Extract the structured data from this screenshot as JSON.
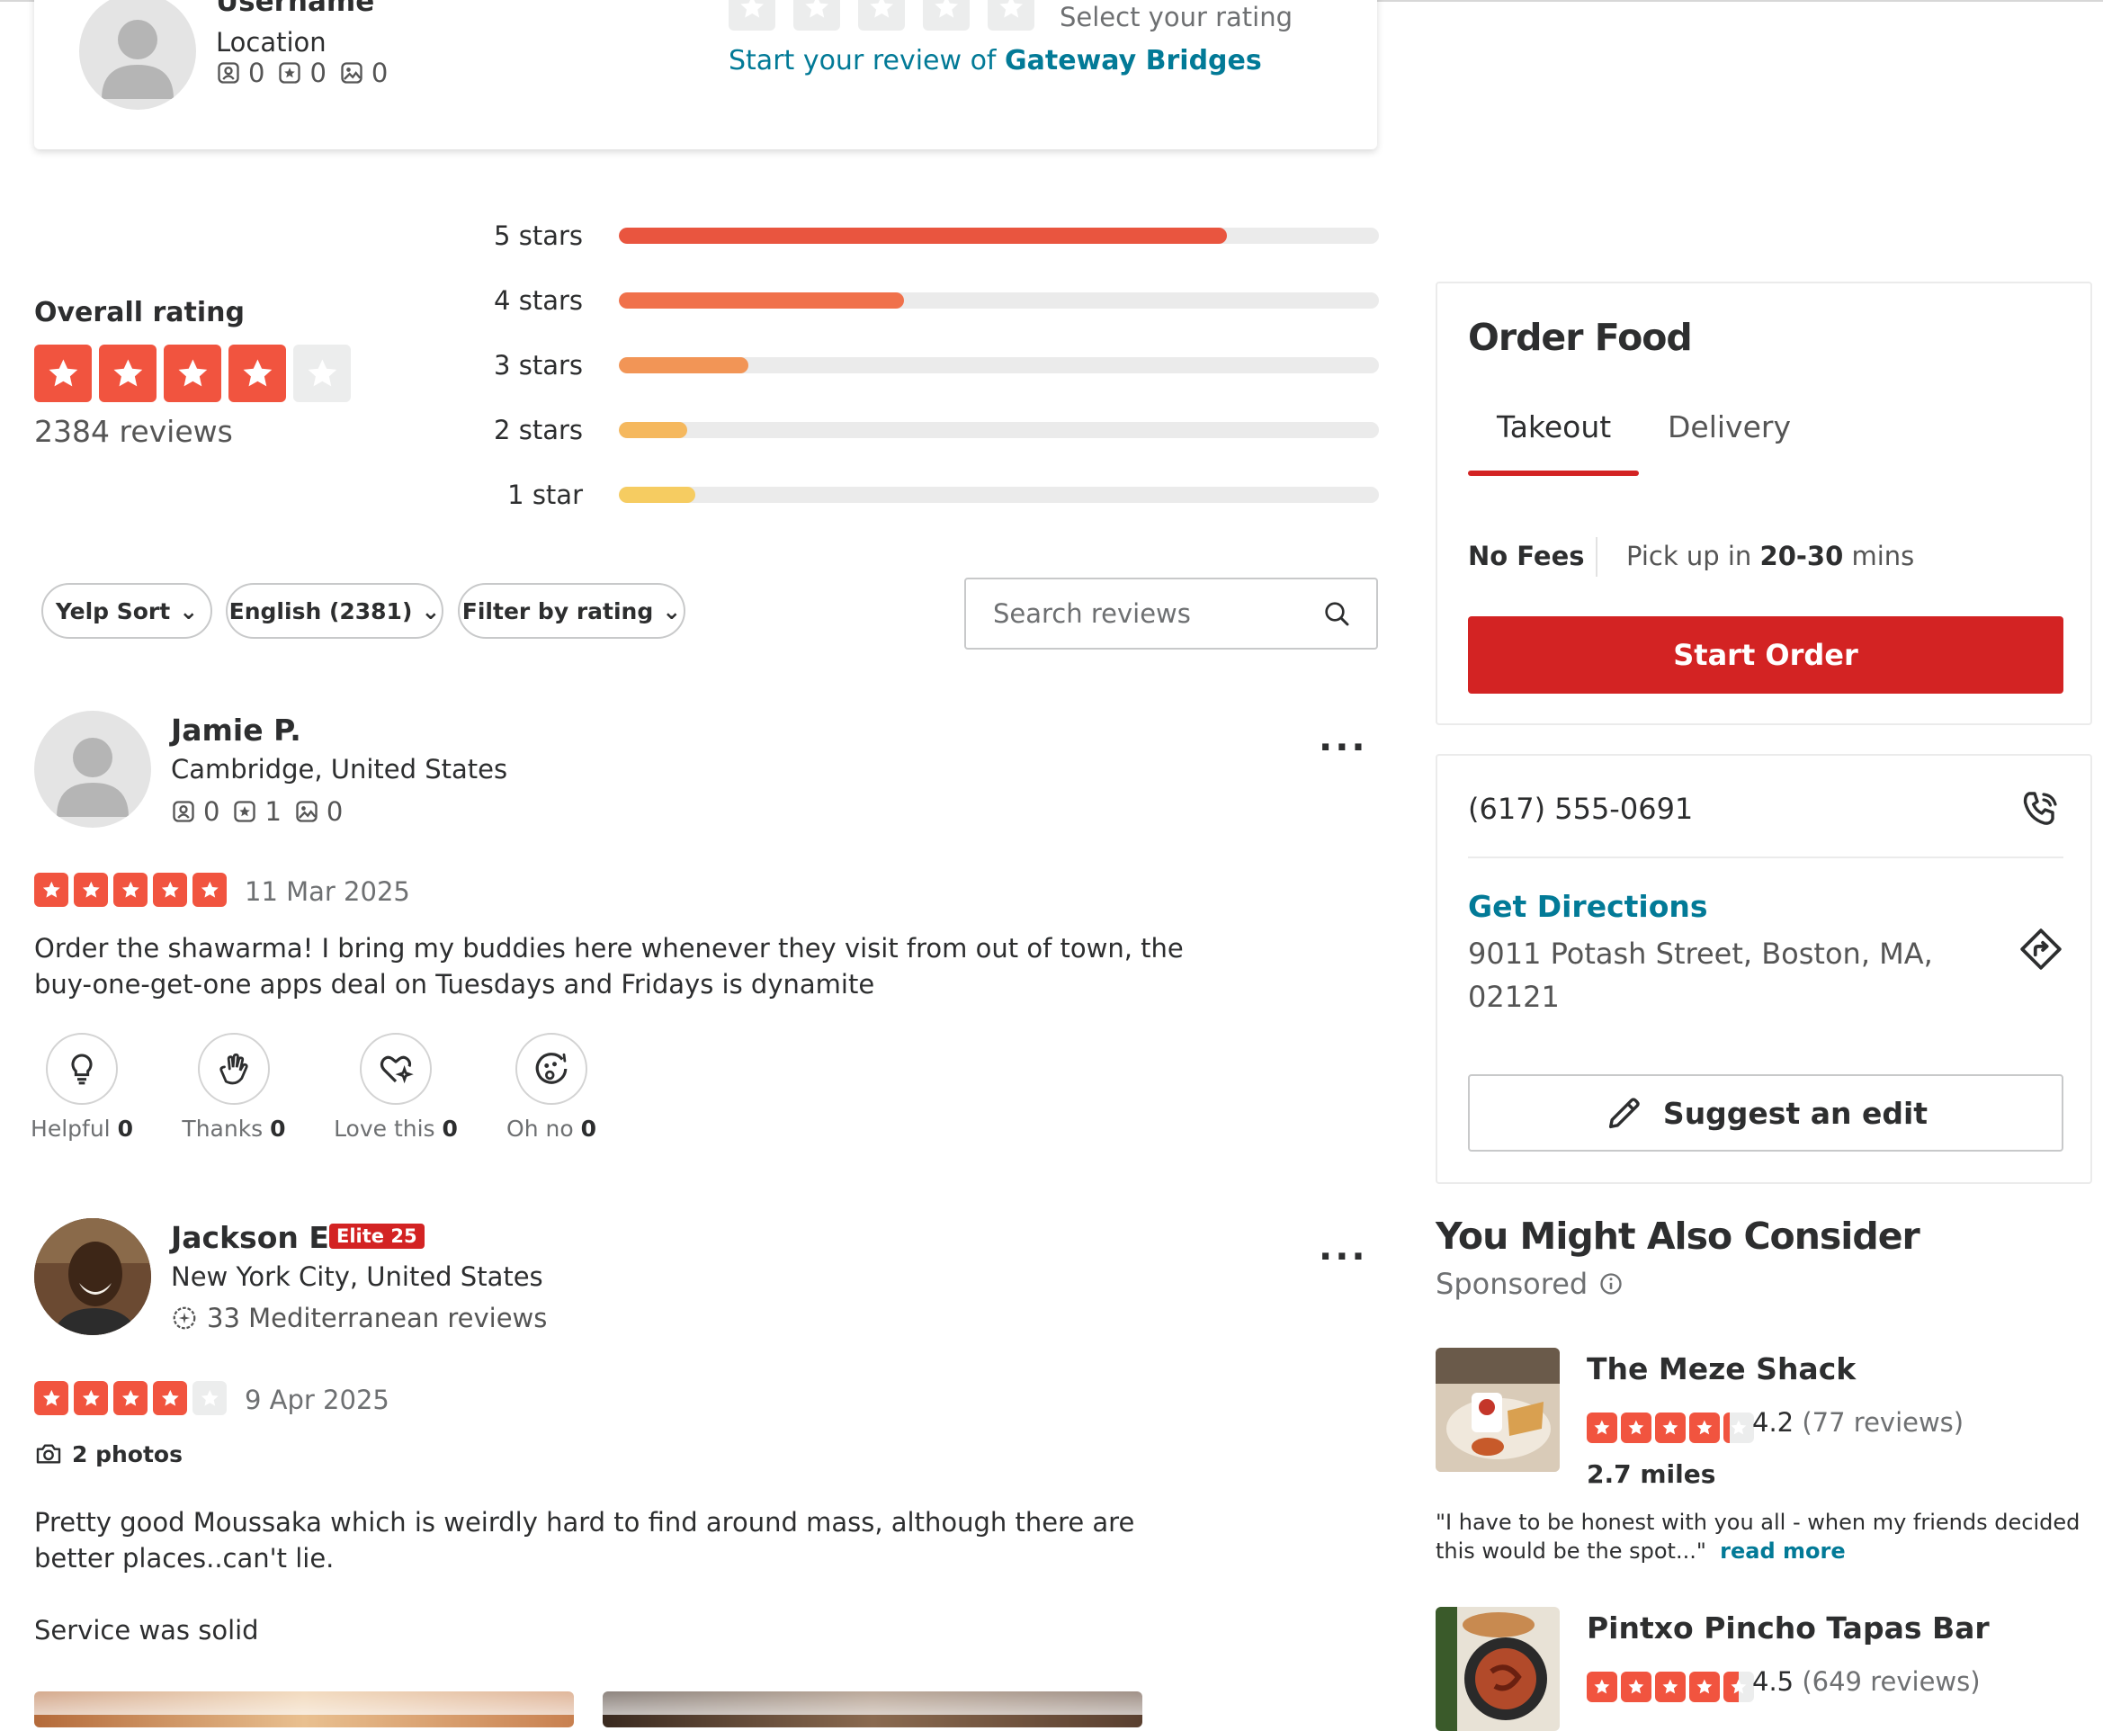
{
  "write_review": {
    "username": "Username",
    "location": "Location",
    "stats": [
      "0",
      "0",
      "0"
    ],
    "select_rating": "Select your rating",
    "start_prefix": "Start your review of ",
    "business": "Gateway Bridges"
  },
  "overall": {
    "heading": "Overall rating",
    "rating": 4,
    "reviews": "2384 reviews",
    "histogram": [
      {
        "label": "5 stars",
        "fraction": 0.8,
        "color": "#e9553f"
      },
      {
        "label": "4 stars",
        "fraction": 0.375,
        "color": "#f0714b"
      },
      {
        "label": "3 stars",
        "fraction": 0.17,
        "color": "#f29556"
      },
      {
        "label": "2 stars",
        "fraction": 0.09,
        "color": "#f5b85e"
      },
      {
        "label": "1 star",
        "fraction": 0.1,
        "color": "#f6cc61"
      }
    ]
  },
  "filters": {
    "sort": "Yelp Sort",
    "language": "English (2381)",
    "rating": "Filter by rating",
    "search_placeholder": "Search reviews"
  },
  "reviews": [
    {
      "name": "Jamie P.",
      "location": "Cambridge, United States",
      "stats": [
        "0",
        "1",
        "0"
      ],
      "rating": 5,
      "date": "11 Mar 2025",
      "text": "Order the shawarma! I bring my buddies here whenever they visit from out of town, the buy-one-get-one apps deal on Tuesdays and Fridays is dynamite",
      "reactions": [
        {
          "label": "Helpful",
          "count": "0"
        },
        {
          "label": "Thanks",
          "count": "0"
        },
        {
          "label": "Love this",
          "count": "0"
        },
        {
          "label": "Oh no",
          "count": "0"
        }
      ]
    },
    {
      "name": "Jackson E.",
      "badge": "Elite 25",
      "location": "New York City, United States",
      "cuisine_reviews": "33 Mediterranean reviews",
      "rating": 4,
      "date": "9 Apr 2025",
      "photos": "2 photos",
      "text1": "Pretty good Moussaka which is weirdly hard to find around mass, although there are better places..can't lie.",
      "text2": "Service was solid"
    }
  ],
  "order": {
    "title": "Order Food",
    "tabs": [
      "Takeout",
      "Delivery"
    ],
    "active_tab": "Takeout",
    "no_fees": "No Fees",
    "pickup_prefix": "Pick up in ",
    "pickup_time": "20-30",
    "pickup_suffix": " mins",
    "button": "Start Order"
  },
  "contact": {
    "phone": "(617) 555-0691",
    "directions": "Get Directions",
    "address_line1": "9011 Potash Street, Boston, MA,",
    "address_line2": "02121",
    "suggest": "Suggest an edit"
  },
  "consider": {
    "title": "You Might Also Consider",
    "sponsored": "Sponsored",
    "items": [
      {
        "name": "The Meze Shack",
        "rating": 4.2,
        "rating_text": "4.2",
        "reviews": "(77 reviews)",
        "distance": "2.7 miles",
        "quote": "\"I have to be honest with you all - when my friends decided this would be the spot...\"",
        "read_more": "read more"
      },
      {
        "name": "Pintxo Pincho Tapas Bar",
        "rating": 4.5,
        "rating_text": "4.5",
        "reviews": "(649 reviews)"
      }
    ]
  },
  "colors": {
    "brand_red": "#d32323",
    "teal_link": "#027a97",
    "star_red": "#f1543f",
    "star_empty": "#eceded"
  }
}
